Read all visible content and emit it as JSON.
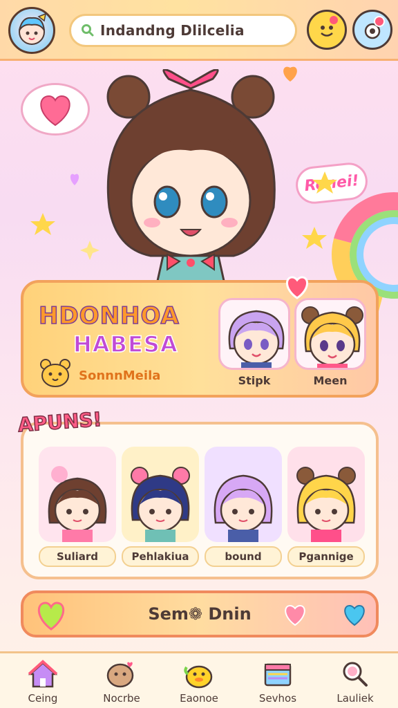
{
  "header": {
    "search_text": "Indandng Dlilcelia",
    "avatar_icon": "profile-avatar-icon",
    "smile_icon": "smiley-face-icon",
    "settings_icon": "settings-toggle-icon"
  },
  "hero": {
    "speech_text": "Ronei!"
  },
  "featured": {
    "title_line1": "HDONHOA",
    "title_line2": "HABESA",
    "subtitle": "SonnnMeila",
    "characters": [
      {
        "name": "Stipk"
      },
      {
        "name": "Meen"
      }
    ]
  },
  "friends": {
    "title": "APUNS!",
    "cards": [
      {
        "name": "Suliard"
      },
      {
        "name": "Pehlakiua"
      },
      {
        "name": "bound"
      },
      {
        "name": "Pgannige"
      }
    ]
  },
  "send_button": {
    "label": "Sem❁ Dnin"
  },
  "nav": {
    "items": [
      {
        "label": "Ceing",
        "icon": "home-icon"
      },
      {
        "label": "Nocrbe",
        "icon": "chat-icon"
      },
      {
        "label": "Eaonoe",
        "icon": "duck-icon"
      },
      {
        "label": "Sevhos",
        "icon": "store-icon"
      },
      {
        "label": "Lauliek",
        "icon": "search-icon"
      }
    ]
  },
  "colors": {
    "accent": "#ff5aa8",
    "header": "#ffd9a8",
    "border": "#f2a25c"
  }
}
